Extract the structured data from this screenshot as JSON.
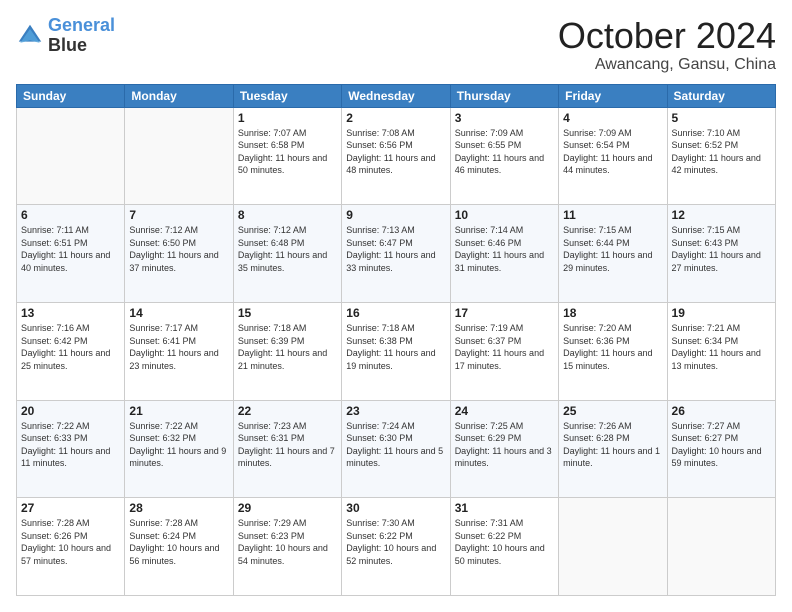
{
  "header": {
    "logo_line1": "General",
    "logo_line2": "Blue",
    "month": "October 2024",
    "location": "Awancang, Gansu, China"
  },
  "weekdays": [
    "Sunday",
    "Monday",
    "Tuesday",
    "Wednesday",
    "Thursday",
    "Friday",
    "Saturday"
  ],
  "weeks": [
    [
      {
        "day": "",
        "info": ""
      },
      {
        "day": "",
        "info": ""
      },
      {
        "day": "1",
        "info": "Sunrise: 7:07 AM\nSunset: 6:58 PM\nDaylight: 11 hours and 50 minutes."
      },
      {
        "day": "2",
        "info": "Sunrise: 7:08 AM\nSunset: 6:56 PM\nDaylight: 11 hours and 48 minutes."
      },
      {
        "day": "3",
        "info": "Sunrise: 7:09 AM\nSunset: 6:55 PM\nDaylight: 11 hours and 46 minutes."
      },
      {
        "day": "4",
        "info": "Sunrise: 7:09 AM\nSunset: 6:54 PM\nDaylight: 11 hours and 44 minutes."
      },
      {
        "day": "5",
        "info": "Sunrise: 7:10 AM\nSunset: 6:52 PM\nDaylight: 11 hours and 42 minutes."
      }
    ],
    [
      {
        "day": "6",
        "info": "Sunrise: 7:11 AM\nSunset: 6:51 PM\nDaylight: 11 hours and 40 minutes."
      },
      {
        "day": "7",
        "info": "Sunrise: 7:12 AM\nSunset: 6:50 PM\nDaylight: 11 hours and 37 minutes."
      },
      {
        "day": "8",
        "info": "Sunrise: 7:12 AM\nSunset: 6:48 PM\nDaylight: 11 hours and 35 minutes."
      },
      {
        "day": "9",
        "info": "Sunrise: 7:13 AM\nSunset: 6:47 PM\nDaylight: 11 hours and 33 minutes."
      },
      {
        "day": "10",
        "info": "Sunrise: 7:14 AM\nSunset: 6:46 PM\nDaylight: 11 hours and 31 minutes."
      },
      {
        "day": "11",
        "info": "Sunrise: 7:15 AM\nSunset: 6:44 PM\nDaylight: 11 hours and 29 minutes."
      },
      {
        "day": "12",
        "info": "Sunrise: 7:15 AM\nSunset: 6:43 PM\nDaylight: 11 hours and 27 minutes."
      }
    ],
    [
      {
        "day": "13",
        "info": "Sunrise: 7:16 AM\nSunset: 6:42 PM\nDaylight: 11 hours and 25 minutes."
      },
      {
        "day": "14",
        "info": "Sunrise: 7:17 AM\nSunset: 6:41 PM\nDaylight: 11 hours and 23 minutes."
      },
      {
        "day": "15",
        "info": "Sunrise: 7:18 AM\nSunset: 6:39 PM\nDaylight: 11 hours and 21 minutes."
      },
      {
        "day": "16",
        "info": "Sunrise: 7:18 AM\nSunset: 6:38 PM\nDaylight: 11 hours and 19 minutes."
      },
      {
        "day": "17",
        "info": "Sunrise: 7:19 AM\nSunset: 6:37 PM\nDaylight: 11 hours and 17 minutes."
      },
      {
        "day": "18",
        "info": "Sunrise: 7:20 AM\nSunset: 6:36 PM\nDaylight: 11 hours and 15 minutes."
      },
      {
        "day": "19",
        "info": "Sunrise: 7:21 AM\nSunset: 6:34 PM\nDaylight: 11 hours and 13 minutes."
      }
    ],
    [
      {
        "day": "20",
        "info": "Sunrise: 7:22 AM\nSunset: 6:33 PM\nDaylight: 11 hours and 11 minutes."
      },
      {
        "day": "21",
        "info": "Sunrise: 7:22 AM\nSunset: 6:32 PM\nDaylight: 11 hours and 9 minutes."
      },
      {
        "day": "22",
        "info": "Sunrise: 7:23 AM\nSunset: 6:31 PM\nDaylight: 11 hours and 7 minutes."
      },
      {
        "day": "23",
        "info": "Sunrise: 7:24 AM\nSunset: 6:30 PM\nDaylight: 11 hours and 5 minutes."
      },
      {
        "day": "24",
        "info": "Sunrise: 7:25 AM\nSunset: 6:29 PM\nDaylight: 11 hours and 3 minutes."
      },
      {
        "day": "25",
        "info": "Sunrise: 7:26 AM\nSunset: 6:28 PM\nDaylight: 11 hours and 1 minute."
      },
      {
        "day": "26",
        "info": "Sunrise: 7:27 AM\nSunset: 6:27 PM\nDaylight: 10 hours and 59 minutes."
      }
    ],
    [
      {
        "day": "27",
        "info": "Sunrise: 7:28 AM\nSunset: 6:26 PM\nDaylight: 10 hours and 57 minutes."
      },
      {
        "day": "28",
        "info": "Sunrise: 7:28 AM\nSunset: 6:24 PM\nDaylight: 10 hours and 56 minutes."
      },
      {
        "day": "29",
        "info": "Sunrise: 7:29 AM\nSunset: 6:23 PM\nDaylight: 10 hours and 54 minutes."
      },
      {
        "day": "30",
        "info": "Sunrise: 7:30 AM\nSunset: 6:22 PM\nDaylight: 10 hours and 52 minutes."
      },
      {
        "day": "31",
        "info": "Sunrise: 7:31 AM\nSunset: 6:22 PM\nDaylight: 10 hours and 50 minutes."
      },
      {
        "day": "",
        "info": ""
      },
      {
        "day": "",
        "info": ""
      }
    ]
  ]
}
